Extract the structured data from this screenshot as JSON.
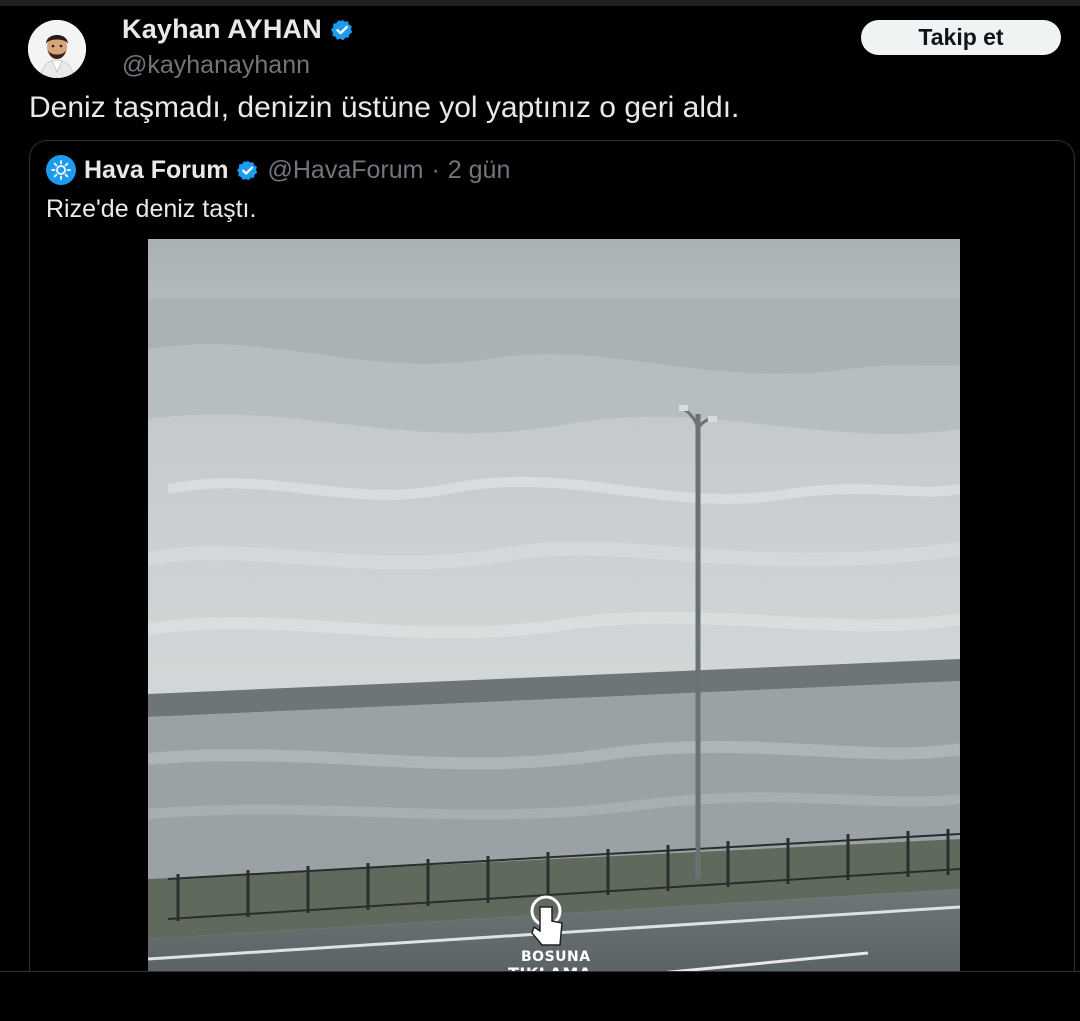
{
  "tweet": {
    "author": {
      "display_name": "Kayhan AYHAN",
      "handle": "@kayhanayhann",
      "verified": true,
      "avatar_icon": "person-portrait-icon"
    },
    "follow_label": "Takip et",
    "text": "Deniz taşmadı, denizin üstüne yol yaptınız o geri aldı."
  },
  "quoted_tweet": {
    "author": {
      "display_name": "Hava Forum",
      "handle": "@HavaForum",
      "verified": true,
      "avatar_icon": "weather-sun-cloud-icon"
    },
    "separator": "·",
    "time": "2 gün",
    "text": "Rize'de deniz taştı.",
    "media": {
      "description_icon": "video-thumbnail",
      "overlay_text_line1": "BOSUNA",
      "overlay_text_line2": "TIKLAMA"
    }
  },
  "colors": {
    "background": "#000000",
    "text_primary": "#e7e9ea",
    "text_secondary": "#71767b",
    "verified_blue": "#1d9bf0",
    "border": "#2f3336",
    "follow_bg": "#eff3f4"
  }
}
